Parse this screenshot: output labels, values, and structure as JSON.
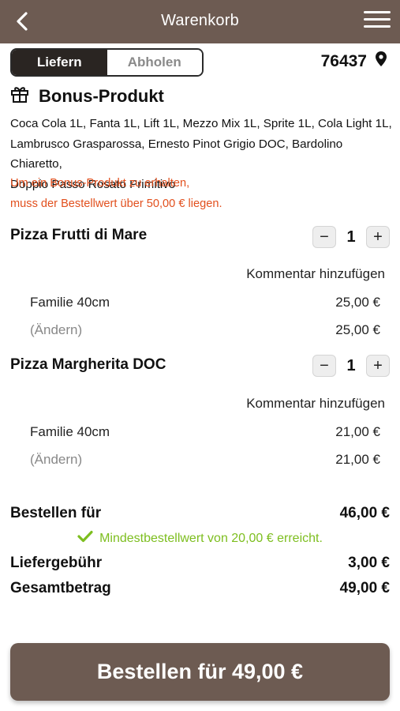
{
  "colors": {
    "header": "#6d5b52",
    "accent_warning": "#e2501e",
    "success": "#7dbe1f",
    "toggle_active": "#2a2522"
  },
  "header": {
    "title": "Warenkorb",
    "back_icon": "chevron-left-icon",
    "menu_icon": "hamburger-menu-icon"
  },
  "delivery_toggle": {
    "options": [
      "Liefern",
      "Abholen"
    ],
    "selected": "Liefern"
  },
  "location": {
    "zip": "76437",
    "icon": "map-pin-icon"
  },
  "bonus": {
    "icon": "gift-icon",
    "title": "Bonus-Produkt",
    "lines": [
      "Coca Cola 1L, Fanta 1L, Lift 1L, Mezzo Mix 1L, Sprite 1L, Cola Light 1L,",
      "Lambrusco Grasparossa, Ernesto Pinot Grigio DOC, Bardolino Chiaretto,",
      "Doppio Passo Rosato Primitivo"
    ],
    "note_lines": [
      "Um ein Bonus-Produkt zu erhalten,",
      "muss der Bestellwert über 50,00 € liegen."
    ]
  },
  "items": [
    {
      "name": "Pizza Frutti di Mare",
      "quantity": "1",
      "comment_label": "Kommentar hinzufügen",
      "option": "Familie 40cm",
      "option_price": "25,00 €",
      "change_label": "(Ändern)",
      "total": "25,00 €"
    },
    {
      "name": "Pizza Margherita DOC",
      "quantity": "1",
      "comment_label": "Kommentar hinzufügen",
      "option": "Familie 40cm",
      "option_price": "21,00 €",
      "change_label": "(Ändern)",
      "total": "21,00 €"
    }
  ],
  "summary": {
    "subtotal_label": "Bestellen für",
    "subtotal_value": "46,00 €",
    "min_order_message": "Mindestbestellwert von 20,00 € erreicht.",
    "delivery_fee_label": "Liefergebühr",
    "delivery_fee_value": "3,00 €",
    "total_label": "Gesamtbetrag",
    "total_value": "49,00 €"
  },
  "order_button": {
    "label": "Bestellen für 49,00 €"
  }
}
